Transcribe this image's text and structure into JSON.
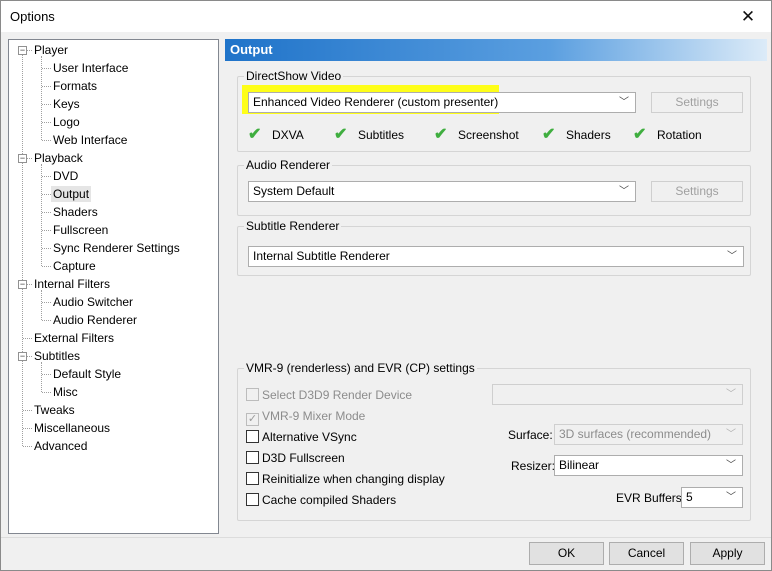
{
  "window": {
    "title": "Options"
  },
  "tree": [
    {
      "label": "Player",
      "level": 0,
      "expander": "−"
    },
    {
      "label": "User Interface",
      "level": 1
    },
    {
      "label": "Formats",
      "level": 1
    },
    {
      "label": "Keys",
      "level": 1
    },
    {
      "label": "Logo",
      "level": 1
    },
    {
      "label": "Web Interface",
      "level": 1
    },
    {
      "label": "Playback",
      "level": 0,
      "expander": "−"
    },
    {
      "label": "DVD",
      "level": 1
    },
    {
      "label": "Output",
      "level": 1,
      "selected": true
    },
    {
      "label": "Shaders",
      "level": 1
    },
    {
      "label": "Fullscreen",
      "level": 1
    },
    {
      "label": "Sync Renderer Settings",
      "level": 1
    },
    {
      "label": "Capture",
      "level": 1
    },
    {
      "label": "Internal Filters",
      "level": 0,
      "expander": "−"
    },
    {
      "label": "Audio Switcher",
      "level": 1
    },
    {
      "label": "Audio Renderer",
      "level": 1
    },
    {
      "label": "External Filters",
      "level": 0
    },
    {
      "label": "Subtitles",
      "level": 0,
      "expander": "−"
    },
    {
      "label": "Default Style",
      "level": 1
    },
    {
      "label": "Misc",
      "level": 1
    },
    {
      "label": "Tweaks",
      "level": 0
    },
    {
      "label": "Miscellaneous",
      "level": 0
    },
    {
      "label": "Advanced",
      "level": 0
    }
  ],
  "panel": {
    "header": "Output",
    "directshow": {
      "legend": "DirectShow Video",
      "renderer": "Enhanced Video Renderer (custom presenter)",
      "settings_label": "Settings",
      "features": [
        "DXVA",
        "Subtitles",
        "Screenshot",
        "Shaders",
        "Rotation"
      ]
    },
    "audio": {
      "legend": "Audio Renderer",
      "renderer": "System Default",
      "settings_label": "Settings"
    },
    "subtitle": {
      "legend": "Subtitle Renderer",
      "renderer": "Internal Subtitle Renderer"
    },
    "vmr": {
      "legend": "VMR-9 (renderless) and EVR (CP) settings",
      "checkboxes": [
        {
          "label": "Select D3D9 Render Device",
          "checked": false,
          "disabled": true
        },
        {
          "label": "VMR-9 Mixer Mode",
          "checked": true,
          "disabled": true
        },
        {
          "label": "Alternative VSync",
          "checked": false,
          "disabled": false
        },
        {
          "label": "D3D Fullscreen",
          "checked": false,
          "disabled": false
        },
        {
          "label": "Reinitialize when changing display",
          "checked": false,
          "disabled": false
        },
        {
          "label": "Cache compiled Shaders",
          "checked": false,
          "disabled": false
        }
      ],
      "device_value": "",
      "surface_label": "Surface:",
      "surface_value": "3D surfaces (recommended)",
      "resizer_label": "Resizer:",
      "resizer_value": "Bilinear",
      "evr_buffers_label": "EVR Buffers:",
      "evr_buffers_value": "5"
    }
  },
  "buttons": {
    "ok": "OK",
    "cancel": "Cancel",
    "apply": "Apply"
  },
  "colors": {
    "header_start": "#1f73c9",
    "highlight": "#ffff00",
    "check_green": "#3fae3f"
  }
}
